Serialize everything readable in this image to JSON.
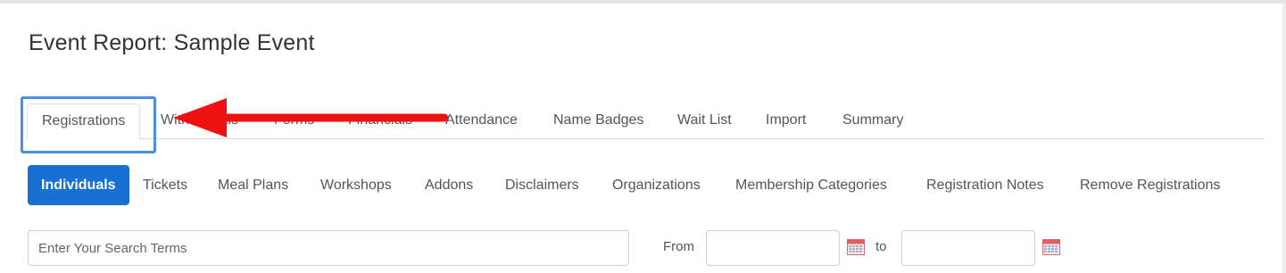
{
  "page": {
    "title": "Event Report: Sample Event"
  },
  "primary_tabs": [
    {
      "label": "Registrations",
      "active": true
    },
    {
      "label": "Withdrawals"
    },
    {
      "label": "Forms"
    },
    {
      "label": "Financials"
    },
    {
      "label": "Attendance"
    },
    {
      "label": "Name Badges"
    },
    {
      "label": "Wait List"
    },
    {
      "label": "Import"
    },
    {
      "label": "Summary"
    }
  ],
  "sub_tabs": [
    {
      "label": "Individuals",
      "active": true
    },
    {
      "label": "Tickets"
    },
    {
      "label": "Meal Plans"
    },
    {
      "label": "Workshops"
    },
    {
      "label": "Addons"
    },
    {
      "label": "Disclaimers"
    },
    {
      "label": "Organizations"
    },
    {
      "label": "Membership Categories"
    },
    {
      "label": "Registration Notes"
    },
    {
      "label": "Remove Registrations"
    }
  ],
  "filters": {
    "search_placeholder": "Enter Your Search Terms",
    "search_value": "",
    "from_label": "From",
    "to_label": "to",
    "from_value": "",
    "to_value": ""
  },
  "colors": {
    "accent": "#1770d2",
    "highlight": "#4a8fe7",
    "arrow": "#ee1111"
  },
  "icons": {
    "calendar": "calendar-icon",
    "annotation": "arrow-left-icon"
  }
}
